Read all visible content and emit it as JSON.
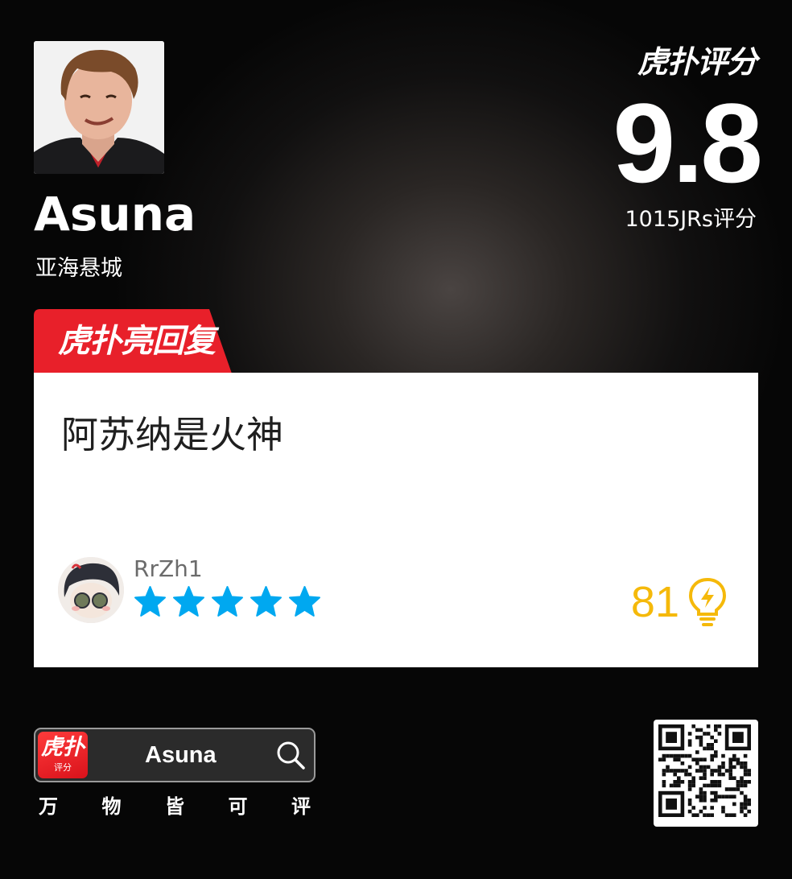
{
  "player": {
    "name": "Asuna",
    "team": "亚海悬城"
  },
  "score": {
    "brand": "虎扑评分",
    "value": "9.8",
    "count_text": "1015JRs评分"
  },
  "hot_reply": {
    "tag_label": "虎扑亮回复",
    "tag_color": "#e8202a",
    "comment": "阿苏纳是火神",
    "user": "RrZh1",
    "stars": 5,
    "star_color": "#00a8f0",
    "likes": "81",
    "like_color": "#f5b90a"
  },
  "search": {
    "app_icon_top": "虎扑",
    "app_icon_bottom": "评分",
    "query": "Asuna"
  },
  "slogan": [
    "万",
    "物",
    "皆",
    "可",
    "评"
  ]
}
